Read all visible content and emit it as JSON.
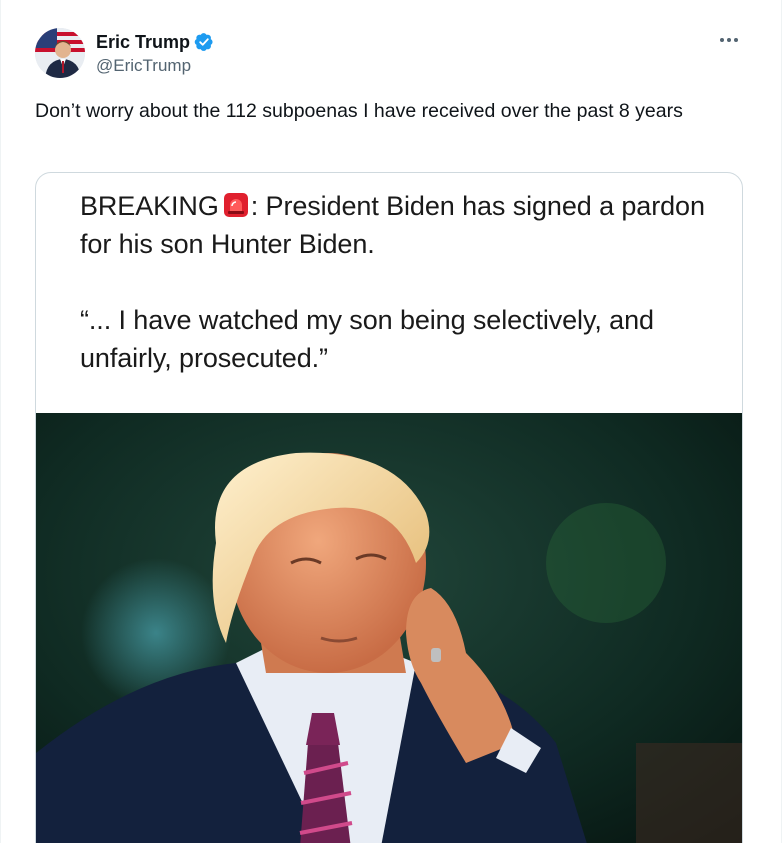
{
  "author": {
    "display_name": "Eric Trump",
    "handle": "@EricTrump",
    "verified_icon": "verified-badge-icon",
    "avatar_icon": "avatar"
  },
  "tweet": {
    "text": "Don’t worry about the 112 subpoenas I have received over the past 8 years"
  },
  "media": {
    "headline_prefix": "BREAKING",
    "headline_icon": "siren-icon",
    "headline_rest": ": President Biden has signed a pardon for his son Hunter Biden.",
    "quote": "“... I have watched my son being selectively, and unfairly, prosecuted.”",
    "photo_icon": "photo-man-touching-ear"
  },
  "colors": {
    "verified_blue": "#1d9bf0",
    "text_primary": "#0f1419",
    "text_secondary": "#536471",
    "border": "#cfd9de",
    "siren_red": "#e0202e"
  },
  "more_menu": {
    "icon": "more-options-icon"
  }
}
